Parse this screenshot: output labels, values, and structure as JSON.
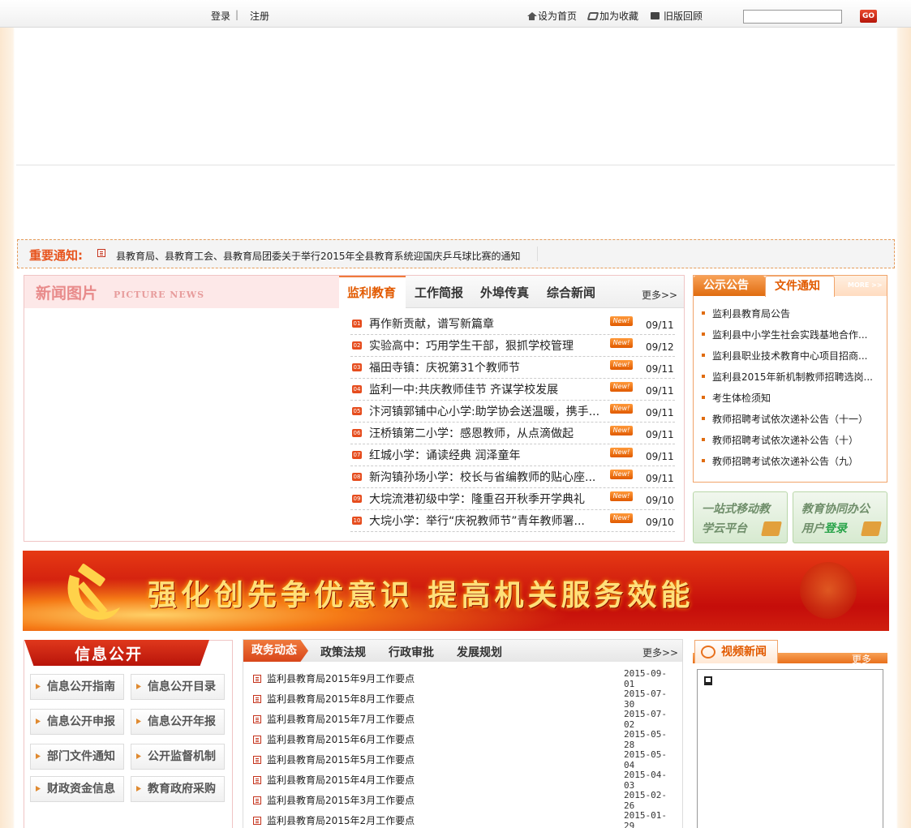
{
  "topbar": {
    "login": "登录",
    "separator": "|",
    "register": "注册",
    "set_home": "设为首页",
    "add_favorite": "加为收藏",
    "old_version": "旧版回顾",
    "search_placeholder": "",
    "go_label": "GO"
  },
  "notice": {
    "tag": "重要通知:",
    "text": "县教育局、县教育工会、县教育局团委关于举行2015年全县教育系统迎国庆乒乓球比赛的通知"
  },
  "news": {
    "picture_title": "新闻图片",
    "picture_subtitle": "PICTURE NEWS",
    "tabs": [
      "监利教育",
      "工作简报",
      "外埠传真",
      "综合新闻"
    ],
    "more": "更多>>",
    "new_label": "New!",
    "items": [
      {
        "num": "01",
        "title": "再作新贡献，谱写新篇章",
        "date": "09/11"
      },
      {
        "num": "02",
        "title": "实验高中：巧用学生干部，狠抓学校管理",
        "date": "09/12"
      },
      {
        "num": "03",
        "title": "福田寺镇：庆祝第31个教师节",
        "date": "09/11"
      },
      {
        "num": "04",
        "title": "监利一中:共庆教师佳节 齐谋学校发展",
        "date": "09/11"
      },
      {
        "num": "05",
        "title": "汴河镇郭铺中心小学:助学协会送温暖，携手...",
        "date": "09/11"
      },
      {
        "num": "06",
        "title": "汪桥镇第二小学：感恩教师，从点滴做起",
        "date": "09/11"
      },
      {
        "num": "07",
        "title": "红城小学：诵读经典 润泽童年",
        "date": "09/11"
      },
      {
        "num": "08",
        "title": "新沟镇孙场小学：校长与省编教师的贴心座...",
        "date": "09/11"
      },
      {
        "num": "09",
        "title": "大垸流港初级中学：隆重召开秋季开学典礼",
        "date": "09/10"
      },
      {
        "num": "10",
        "title": "大垸小学：举行“庆祝教师节”青年教师署...",
        "date": "09/10"
      }
    ]
  },
  "announcement": {
    "tab1": "公示公告",
    "tab2": "文件通知",
    "more": "MORE >>",
    "items": [
      "监利县教育局公告",
      "监利县中小学生社会实践基地合作...",
      "监利县职业技术教育中心项目招商...",
      "监利县2015年新机制教师招聘选岗...",
      "考生体检须知",
      "教师招聘考试依次递补公告（十一）",
      "教师招聘考试依次递补公告（十）",
      "教师招聘考试依次递补公告（九）"
    ]
  },
  "quick": {
    "b1_line1": "一站式移动教",
    "b1_line2": "学云平台",
    "b2_line1": "教育协同办公",
    "b2_line2_a": "用户",
    "b2_line2_b": "登录"
  },
  "slogan": {
    "text": "强化创先争优意识  提高机关服务效能"
  },
  "info": {
    "title": "信息公开",
    "buttons": [
      "信息公开指南",
      "信息公开目录",
      "信息公开申报",
      "信息公开年报",
      "部门文件通知",
      "公开监督机制",
      "财政资金信息",
      "教育政府采购"
    ]
  },
  "gov": {
    "tabs": [
      "政务动态",
      "政策法规",
      "行政审批",
      "发展规划"
    ],
    "more": "更多>>",
    "items": [
      {
        "title": "监利县教育局2015年9月工作要点",
        "date": "2015-09-01"
      },
      {
        "title": "监利县教育局2015年8月工作要点",
        "date": "2015-07-30"
      },
      {
        "title": "监利县教育局2015年7月工作要点",
        "date": "2015-07-02"
      },
      {
        "title": "监利县教育局2015年6月工作要点",
        "date": "2015-05-28"
      },
      {
        "title": "监利县教育局2015年5月工作要点",
        "date": "2015-05-04"
      },
      {
        "title": "监利县教育局2015年4月工作要点",
        "date": "2015-04-03"
      },
      {
        "title": "监利县教育局2015年3月工作要点",
        "date": "2015-02-26"
      },
      {
        "title": "监利县教育局2015年2月工作要点",
        "date": "2015-01-29"
      }
    ]
  },
  "video": {
    "title": "视频新闻",
    "more": "更多"
  },
  "colors": {
    "accent_orange": "#e25a00",
    "accent_red": "#c50d0a",
    "page_side": "#fbe7cf"
  }
}
